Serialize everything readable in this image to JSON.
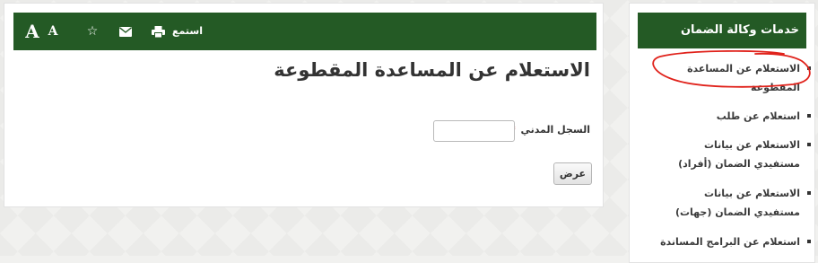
{
  "toolbar": {
    "font_large_label": "A",
    "font_small_label": "A",
    "favorite_icon": "star-icon",
    "email_icon": "envelope-icon",
    "print_icon": "printer-icon",
    "listen_label": "استمع"
  },
  "main": {
    "title": "الاستعلام عن المساعدة المقطوعة",
    "civil_record": {
      "label": "السجل المدني",
      "required_mark": "*",
      "value": ""
    },
    "submit_label": "عرض"
  },
  "sidebar": {
    "title": "خدمات وكالة الضمان",
    "items": [
      {
        "label": "الاستعلام عن المساعدة المقطوعة"
      },
      {
        "label": "استعلام عن طلب"
      },
      {
        "label": "الاستعلام عن بيانات مستفيدي الضمان (أفراد)"
      },
      {
        "label": "الاستعلام عن بيانات مستفيدي الضمان (جهات)"
      },
      {
        "label": "استعلام عن البرامج المساندة"
      }
    ]
  },
  "colors": {
    "header_green": "#245a25",
    "required_red": "#d9231c",
    "annotation_red": "#e0221b"
  }
}
